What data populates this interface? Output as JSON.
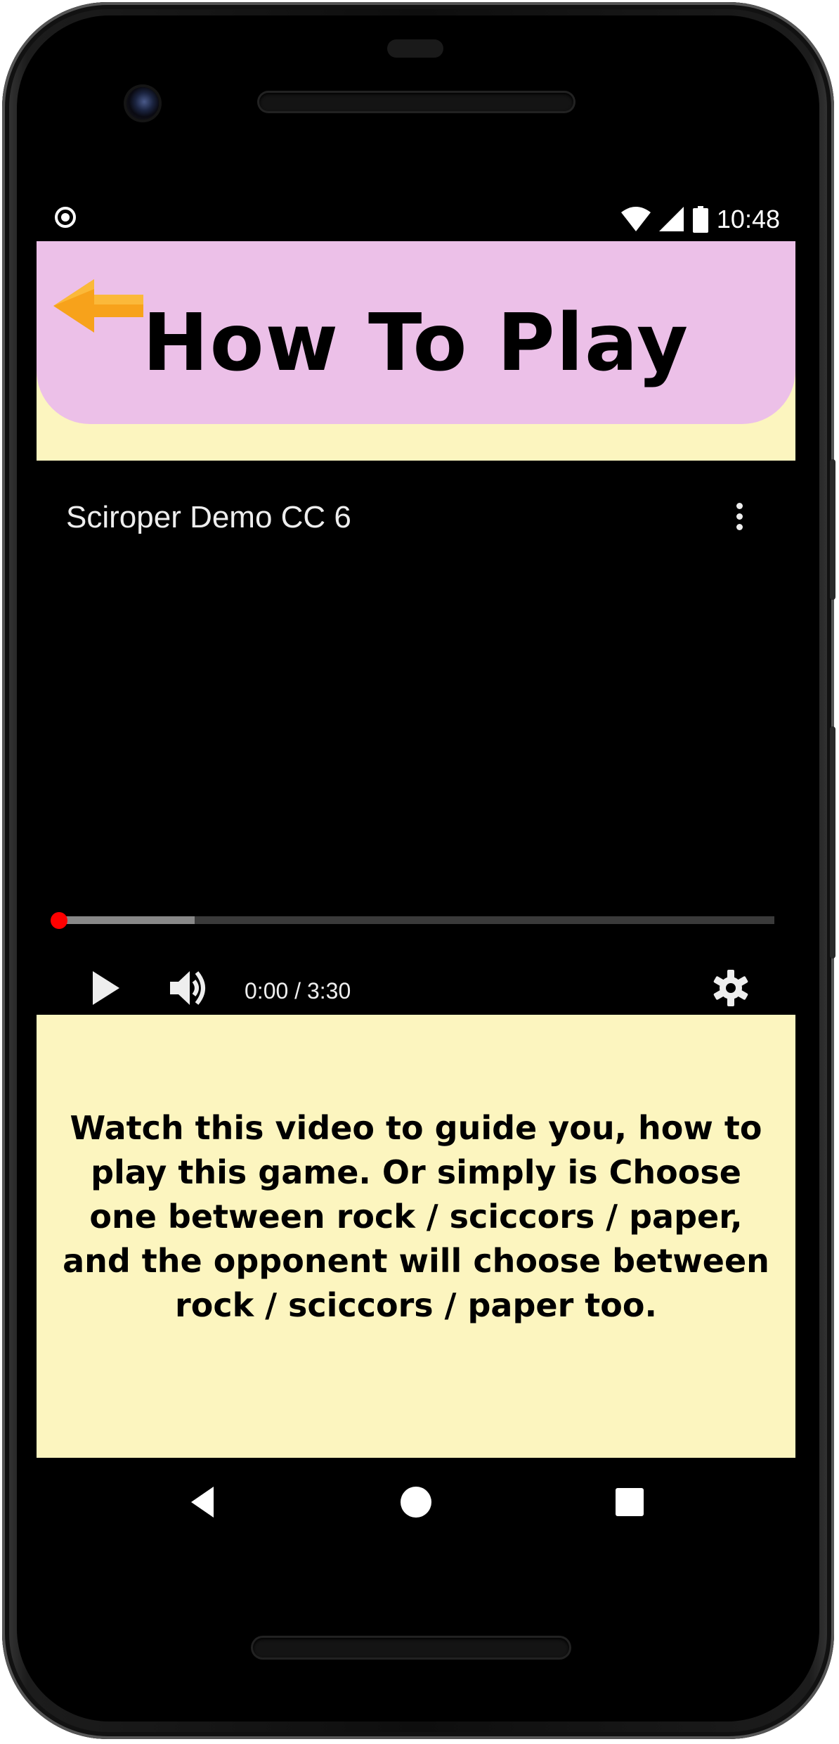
{
  "status_bar": {
    "time": "10:48",
    "icons": [
      "screen-record-icon",
      "wifi-icon",
      "cellular-signal-icon",
      "battery-icon"
    ]
  },
  "header": {
    "title": "How To Play",
    "back_icon": "arrow-left-icon"
  },
  "video_player": {
    "title": "Sciroper Demo CC 6",
    "time_display": "0:00 / 3:30",
    "played_fraction": 0.0,
    "buffered_fraction": 0.19,
    "controls": [
      "play-icon",
      "volume-icon",
      "settings-gear-icon",
      "more-vert-icon"
    ]
  },
  "instructions": {
    "text": "Watch this video to guide you, how to play this game. Or simply is Choose one between rock / sciccors / paper, and the opponent will choose between rock / sciccors / paper too."
  },
  "nav_bar": {
    "buttons": [
      "back-triangle-icon",
      "home-circle-icon",
      "recents-square-icon"
    ]
  },
  "colors": {
    "header_bg": "#ecc0e8",
    "content_bg": "#fcf5bf",
    "back_arrow": "#f7a21b",
    "progress_thumb": "#ff0000"
  }
}
